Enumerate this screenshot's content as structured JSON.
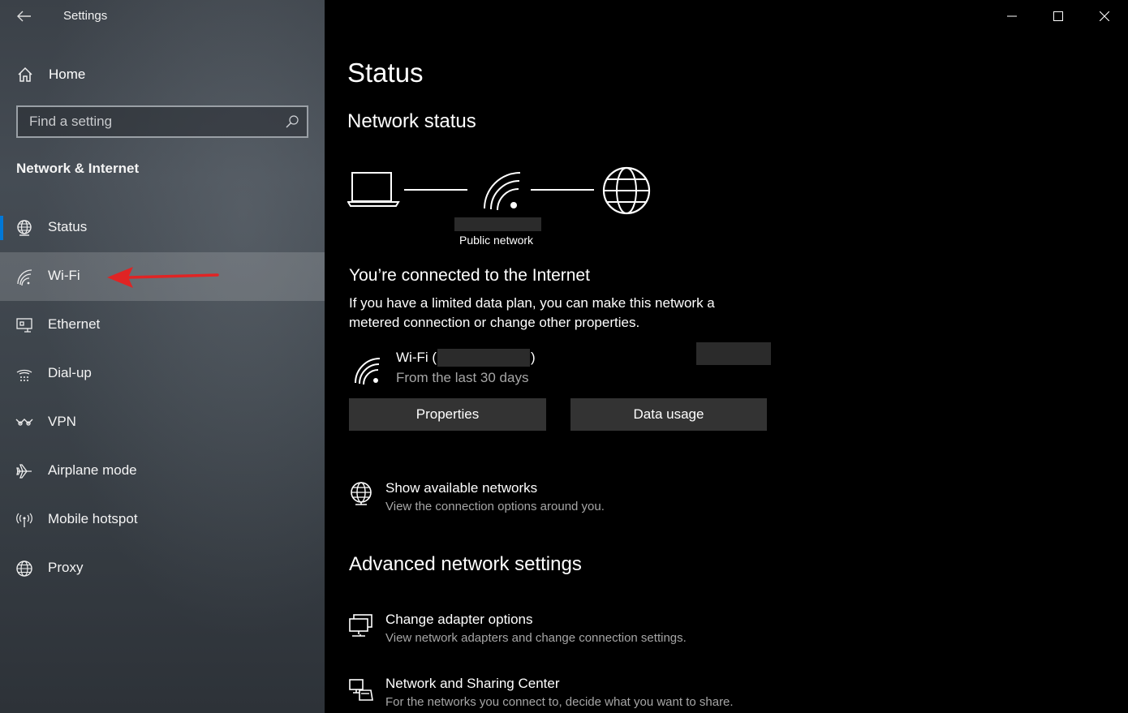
{
  "window": {
    "title": "Settings",
    "controls": [
      "minimize",
      "maximize",
      "close"
    ]
  },
  "sidebar": {
    "home_label": "Home",
    "search_placeholder": "Find a setting",
    "section_title": "Network & Internet",
    "items": [
      {
        "label": "Status",
        "icon": "status-globe-icon",
        "selected": true
      },
      {
        "label": "Wi-Fi",
        "icon": "wifi-icon",
        "hovered": true
      },
      {
        "label": "Ethernet",
        "icon": "ethernet-icon"
      },
      {
        "label": "Dial-up",
        "icon": "dialup-icon"
      },
      {
        "label": "VPN",
        "icon": "vpn-icon"
      },
      {
        "label": "Airplane mode",
        "icon": "airplane-icon"
      },
      {
        "label": "Mobile hotspot",
        "icon": "hotspot-icon"
      },
      {
        "label": "Proxy",
        "icon": "globe-icon"
      }
    ]
  },
  "main": {
    "page_title": "Status",
    "network_status_title": "Network status",
    "network_type": "Public network",
    "connected_title": "You’re connected to the Internet",
    "connected_desc": "If you have a limited data plan, you can make this network a metered connection or change other properties.",
    "wifi": {
      "prefix": "Wi-Fi (",
      "suffix": ")",
      "period": "From the last 30 days"
    },
    "buttons": {
      "properties": "Properties",
      "data_usage": "Data usage"
    },
    "show_networks": {
      "title": "Show available networks",
      "sub": "View the connection options around you."
    },
    "advanced_title": "Advanced network settings",
    "change_adapter": {
      "title": "Change adapter options",
      "sub": "View network adapters and change connection settings."
    },
    "sharing_center": {
      "title": "Network and Sharing Center",
      "sub": "For the networks you connect to, decide what you want to share."
    }
  },
  "colors": {
    "accent": "#0078d7",
    "arrow": "#e02424",
    "button_bg": "#333333",
    "subtext": "#a6a6a6"
  }
}
